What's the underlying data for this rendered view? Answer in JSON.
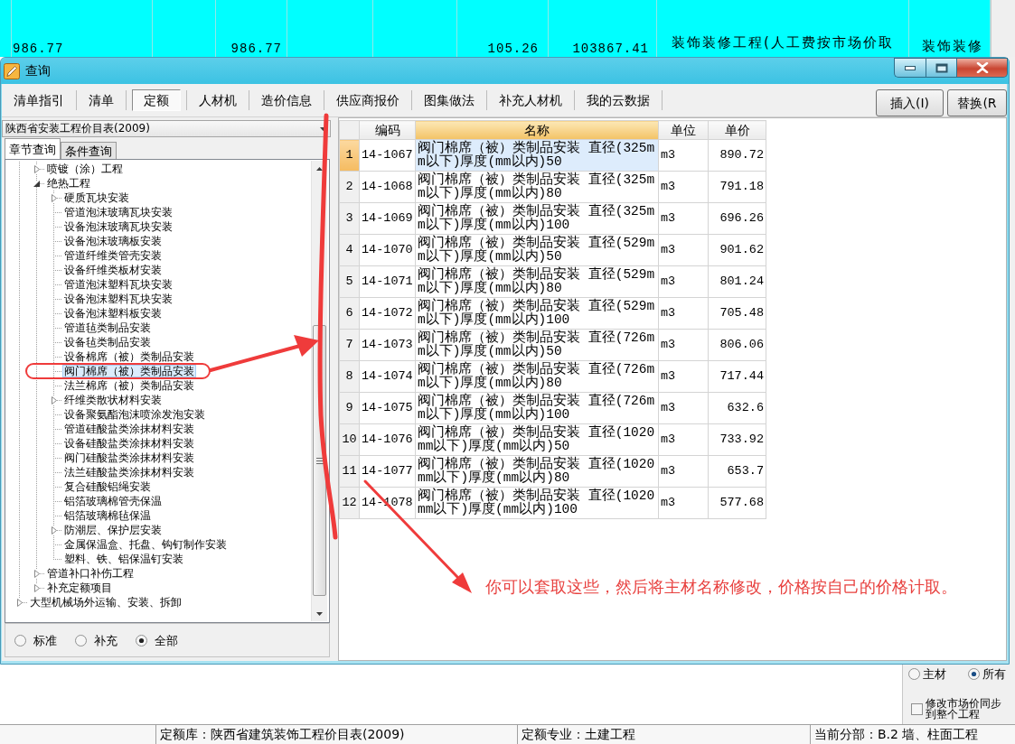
{
  "background_app": {
    "row_cells": [
      "986.77",
      "986.77",
      "105.26",
      "103867.41",
      "装饰装修工程(人工费按市场价取",
      "装饰装修"
    ],
    "material_filter": [
      {
        "label": "主材",
        "selected": false
      },
      {
        "label": "所有",
        "selected": true
      }
    ],
    "sync_checkbox": {
      "label": "修改市场价同步到整个工程",
      "checked": false
    },
    "status_bar": [
      "定额库：陕西省建筑装饰工程价目表(2009)",
      "定额专业：土建工程",
      "当前分部：B.2 墙、柱面工程"
    ]
  },
  "window": {
    "title": "查询"
  },
  "tabs": [
    {
      "label": "清单指引",
      "selected": false
    },
    {
      "label": "清单",
      "selected": false
    },
    {
      "label": "定额",
      "selected": true
    },
    {
      "label": "人材机",
      "selected": false
    },
    {
      "label": "造价信息",
      "selected": false
    },
    {
      "label": "供应商报价",
      "selected": false
    },
    {
      "label": "图集做法",
      "selected": false
    },
    {
      "label": "补充人材机",
      "selected": false
    },
    {
      "label": "我的云数据",
      "selected": false
    }
  ],
  "buttons": [
    "插入(I)",
    "替换(R"
  ],
  "library_select": {
    "value": "陕西省安装工程价目表(2009)"
  },
  "query_tabs": [
    {
      "label": "章节查询",
      "selected": true
    },
    {
      "label": "条件查询",
      "selected": false
    }
  ],
  "tree": {
    "items": [
      {
        "children": [
          {
            "kind": "group",
            "label": "喷镀（涂）工程",
            "expanded": false,
            "selected": false
          },
          {
            "kind": "group",
            "label": "绝热工程",
            "expanded": true,
            "selected": false,
            "children": [
              {
                "kind": "group",
                "label": "硬质瓦块安装",
                "expanded": false,
                "selected": false
              },
              {
                "kind": "leaf",
                "label": "管道泡沫玻璃瓦块安装",
                "selected": false
              },
              {
                "kind": "leaf",
                "label": "设备泡沫玻璃瓦块安装",
                "selected": false
              },
              {
                "kind": "leaf",
                "label": "设备泡沫玻璃板安装",
                "selected": false
              },
              {
                "kind": "leaf",
                "label": "管道纤维类管壳安装",
                "selected": false
              },
              {
                "kind": "leaf",
                "label": "设备纤维类板材安装",
                "selected": false
              },
              {
                "kind": "leaf",
                "label": "管道泡沫塑料瓦块安装",
                "selected": false
              },
              {
                "kind": "leaf",
                "label": "设备泡沫塑料瓦块安装",
                "selected": false
              },
              {
                "kind": "leaf",
                "label": "设备泡沫塑料板安装",
                "selected": false
              },
              {
                "kind": "leaf",
                "label": "管道毡类制品安装",
                "selected": false
              },
              {
                "kind": "leaf",
                "label": "设备毡类制品安装",
                "selected": false
              },
              {
                "kind": "leaf",
                "label": "设备棉席（被）类制品安装",
                "selected": false
              },
              {
                "kind": "leaf",
                "label": "阀门棉席（被）类制品安装",
                "selected": true
              },
              {
                "kind": "leaf",
                "label": "法兰棉席（被）类制品安装",
                "selected": false
              },
              {
                "kind": "group",
                "label": "纤维类散状材料安装",
                "expanded": false,
                "selected": false
              },
              {
                "kind": "leaf",
                "label": "设备聚氨酯泡沫喷涂发泡安装",
                "selected": false
              },
              {
                "kind": "leaf",
                "label": "管道硅酸盐类涂抹材料安装",
                "selected": false
              },
              {
                "kind": "leaf",
                "label": "设备硅酸盐类涂抹材料安装",
                "selected": false
              },
              {
                "kind": "leaf",
                "label": "阀门硅酸盐类涂抹材料安装",
                "selected": false
              },
              {
                "kind": "leaf",
                "label": "法兰硅酸盐类涂抹材料安装",
                "selected": false
              },
              {
                "kind": "leaf",
                "label": "复合硅酸铝绳安装",
                "selected": false
              },
              {
                "kind": "leaf",
                "label": "铝箔玻璃棉管壳保温",
                "selected": false
              },
              {
                "kind": "leaf",
                "label": "铝箔玻璃棉毡保温",
                "selected": false
              },
              {
                "kind": "group",
                "label": "防潮层、保护层安装",
                "expanded": false,
                "selected": false
              },
              {
                "kind": "leaf",
                "label": "金属保温盒、托盘、钩钉制作安装",
                "selected": false
              },
              {
                "kind": "leaf",
                "label": "塑料、铁、铝保温钉安装",
                "selected": false
              }
            ]
          },
          {
            "kind": "group",
            "label": "管道补口补伤工程",
            "expanded": false,
            "selected": false
          },
          {
            "kind": "group",
            "label": "补充定额项目",
            "expanded": false,
            "selected": false
          }
        ]
      },
      {
        "kind": "group",
        "label": "大型机械场外运输、安装、拆卸",
        "expanded": false,
        "selected": false
      }
    ]
  },
  "filter_radios": [
    {
      "label": "标准",
      "selected": false
    },
    {
      "label": "补充",
      "selected": false
    },
    {
      "label": "全部",
      "selected": true
    }
  ],
  "table": {
    "columns": [
      {
        "label": "编码",
        "selected": false
      },
      {
        "label": "名称",
        "selected": true
      },
      {
        "label": "单位",
        "selected": false
      },
      {
        "label": "单价",
        "selected": false
      }
    ],
    "rows": [
      {
        "number": "1",
        "code": "14-1067",
        "name": "阀门棉席（被）类制品安装 直径(325mm以下)厚度(mm以内)50",
        "unit": "m3",
        "price": "890.72",
        "selected": true
      },
      {
        "number": "2",
        "code": "14-1068",
        "name": "阀门棉席（被）类制品安装 直径(325mm以下)厚度(mm以内)80",
        "unit": "m3",
        "price": "791.18",
        "selected": false
      },
      {
        "number": "3",
        "code": "14-1069",
        "name": "阀门棉席（被）类制品安装 直径(325mm以下)厚度(mm以内)100",
        "unit": "m3",
        "price": "696.26",
        "selected": false
      },
      {
        "number": "4",
        "code": "14-1070",
        "name": "阀门棉席（被）类制品安装 直径(529mm以下)厚度(mm以内)50",
        "unit": "m3",
        "price": "901.62",
        "selected": false
      },
      {
        "number": "5",
        "code": "14-1071",
        "name": "阀门棉席（被）类制品安装 直径(529mm以下)厚度(mm以内)80",
        "unit": "m3",
        "price": "801.24",
        "selected": false
      },
      {
        "number": "6",
        "code": "14-1072",
        "name": "阀门棉席（被）类制品安装 直径(529mm以下)厚度(mm以内)100",
        "unit": "m3",
        "price": "705.48",
        "selected": false
      },
      {
        "number": "7",
        "code": "14-1073",
        "name": "阀门棉席（被）类制品安装 直径(726mm以下)厚度(mm以内)50",
        "unit": "m3",
        "price": "806.06",
        "selected": false
      },
      {
        "number": "8",
        "code": "14-1074",
        "name": "阀门棉席（被）类制品安装 直径(726mm以下)厚度(mm以内)80",
        "unit": "m3",
        "price": "717.44",
        "selected": false
      },
      {
        "number": "9",
        "code": "14-1075",
        "name": "阀门棉席（被）类制品安装 直径(726mm以下)厚度(mm以内)100",
        "unit": "m3",
        "price": "632.6",
        "selected": false
      },
      {
        "number": "10",
        "code": "14-1076",
        "name": "阀门棉席（被）类制品安装 直径(1020mm以下)厚度(mm以内)50",
        "unit": "m3",
        "price": "733.92",
        "selected": false
      },
      {
        "number": "11",
        "code": "14-1077",
        "name": "阀门棉席（被）类制品安装 直径(1020mm以下)厚度(mm以内)80",
        "unit": "m3",
        "price": "653.7",
        "selected": false
      },
      {
        "number": "12",
        "code": "14-1078",
        "name": "阀门棉席（被）类制品安装 直径(1020mm以下)厚度(mm以内)100",
        "unit": "m3",
        "price": "577.68",
        "selected": false
      }
    ]
  },
  "annotation": {
    "text": "你可以套取这些，然后将主材名称修改，价格按自己的价格计取。"
  }
}
